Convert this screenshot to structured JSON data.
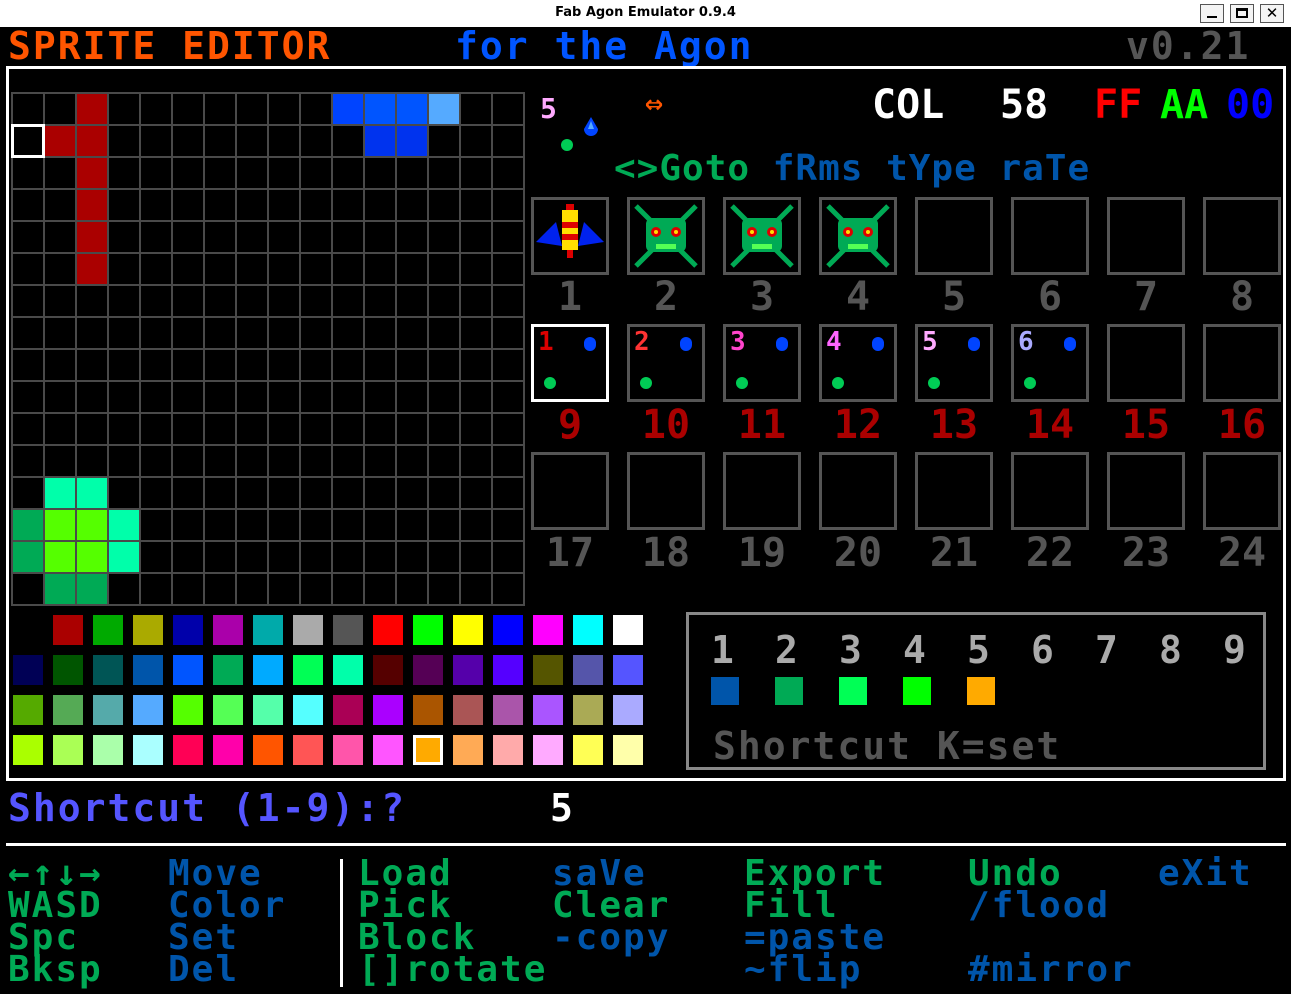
{
  "window": {
    "title": "Fab Agon Emulator 0.9.4"
  },
  "header": {
    "word1": "SPRITE EDITOR",
    "word2": "for the Agon",
    "version": "v0.21"
  },
  "status": {
    "frame_badge": "5",
    "arrow_glyph": "⇔",
    "col_label": "COL",
    "col_index": "58",
    "hex_r": "FF",
    "hex_g": "AA",
    "hex_b": "00",
    "menu": "<>Goto fRms tYpe raTe"
  },
  "grid": {
    "size": 16,
    "cursor": [
      0,
      1
    ],
    "pixels": [
      {
        "r": 0,
        "c": 2,
        "color": "#aa0000"
      },
      {
        "r": 0,
        "c": 10,
        "color": "#0044ff"
      },
      {
        "r": 0,
        "c": 11,
        "color": "#0055ff"
      },
      {
        "r": 0,
        "c": 12,
        "color": "#0055ff"
      },
      {
        "r": 0,
        "c": 13,
        "color": "#55aaff"
      },
      {
        "r": 1,
        "c": 1,
        "color": "#aa0000"
      },
      {
        "r": 1,
        "c": 2,
        "color": "#aa0000"
      },
      {
        "r": 1,
        "c": 11,
        "color": "#0033ee"
      },
      {
        "r": 1,
        "c": 12,
        "color": "#0033ee"
      },
      {
        "r": 2,
        "c": 2,
        "color": "#aa0000"
      },
      {
        "r": 3,
        "c": 2,
        "color": "#aa0000"
      },
      {
        "r": 4,
        "c": 2,
        "color": "#aa0000"
      },
      {
        "r": 5,
        "c": 2,
        "color": "#aa0000"
      },
      {
        "r": 12,
        "c": 1,
        "color": "#00ffaa"
      },
      {
        "r": 12,
        "c": 2,
        "color": "#00ffaa"
      },
      {
        "r": 13,
        "c": 0,
        "color": "#00aa55"
      },
      {
        "r": 13,
        "c": 1,
        "color": "#55ff00"
      },
      {
        "r": 13,
        "c": 2,
        "color": "#55ff00"
      },
      {
        "r": 13,
        "c": 3,
        "color": "#00ffaa"
      },
      {
        "r": 14,
        "c": 0,
        "color": "#00aa55"
      },
      {
        "r": 14,
        "c": 1,
        "color": "#55ff00"
      },
      {
        "r": 14,
        "c": 2,
        "color": "#55ff00"
      },
      {
        "r": 14,
        "c": 3,
        "color": "#00ffaa"
      },
      {
        "r": 15,
        "c": 1,
        "color": "#00aa55"
      },
      {
        "r": 15,
        "c": 2,
        "color": "#00aa55"
      }
    ]
  },
  "sprites": {
    "row1_numbers": [
      "1",
      "2",
      "3",
      "4",
      "5",
      "6",
      "7",
      "8"
    ],
    "row2_numbers": [
      "9",
      "10",
      "11",
      "12",
      "13",
      "14",
      "15",
      "16"
    ],
    "row3_numbers": [
      "17",
      "18",
      "19",
      "20",
      "21",
      "22",
      "23",
      "24"
    ],
    "row1_icons": [
      "bee-sprite-icon",
      "alien-sprite-icon",
      "alien-sprite-icon",
      "alien-sprite-icon",
      "",
      "",
      "",
      ""
    ],
    "row2_labels": [
      "1",
      "2",
      "3",
      "4",
      "5",
      "6",
      "",
      ""
    ],
    "row2_label_colors": [
      "#dd0000",
      "#ff3333",
      "#ff44cc",
      "#ff66ff",
      "#ffaaff",
      "#aaaaff",
      "",
      ""
    ],
    "selected_frame": 9
  },
  "palette": {
    "selected": "#ffaa00",
    "rows": [
      [
        "#000000",
        "#aa0000",
        "#00aa00",
        "#aaaa00",
        "#0000aa",
        "#aa00aa",
        "#00aaaa",
        "#aaaaaa",
        "#555555",
        "#ff0000",
        "#00ff00",
        "#ffff00",
        "#0000ff",
        "#ff00ff",
        "#00ffff",
        "#ffffff"
      ],
      [
        "#000055",
        "#005500",
        "#005555",
        "#0055aa",
        "#0055ff",
        "#00aa55",
        "#00aaff",
        "#00ff55",
        "#00ffaa",
        "#550000",
        "#550055",
        "#5500aa",
        "#5500ff",
        "#555500",
        "#5555aa",
        "#5555ff"
      ],
      [
        "#55aa00",
        "#55aa55",
        "#55aaaa",
        "#55aaff",
        "#55ff00",
        "#55ff55",
        "#55ffaa",
        "#55ffff",
        "#aa0055",
        "#aa00ff",
        "#aa5500",
        "#aa5555",
        "#aa55aa",
        "#aa55ff",
        "#aaaa55",
        "#aaaaff"
      ],
      [
        "#aaff00",
        "#aaff55",
        "#aaffaa",
        "#aaffff",
        "#ff0055",
        "#ff00aa",
        "#ff5500",
        "#ff5555",
        "#ff55aa",
        "#ff55ff",
        "#ffaa00",
        "#ffaa55",
        "#ffaaaa",
        "#ffaaff",
        "#ffff55",
        "#ffffaa"
      ]
    ]
  },
  "shortcuts": {
    "numbers": [
      "1",
      "2",
      "3",
      "4",
      "5",
      "6",
      "7",
      "8",
      "9"
    ],
    "colors": [
      "#0055aa",
      "#00aa55",
      "#00ff55",
      "#00ff00",
      "#ffaa00"
    ],
    "label": "Shortcut K=set"
  },
  "prompt": {
    "text": "Shortcut (1-9):?",
    "value": "5"
  },
  "help": {
    "arrows": "←↑↓→",
    "move": "Move",
    "wasd": "WASD",
    "color": "Color",
    "spc": "Spc",
    "set": "Set",
    "bksp": "Bksp",
    "del": "Del",
    "load": "Load",
    "save": "saVe",
    "export": "Export",
    "undo": "Undo",
    "exit": "eXit",
    "pick": "Pick",
    "clear": "Clear",
    "fill": "Fill",
    "flood": "/flood",
    "block": "Block",
    "copy": "-copy",
    "paste": "=paste",
    "rotate": "[]rotate",
    "flip": "~flip",
    "mirror": "#mirror"
  }
}
